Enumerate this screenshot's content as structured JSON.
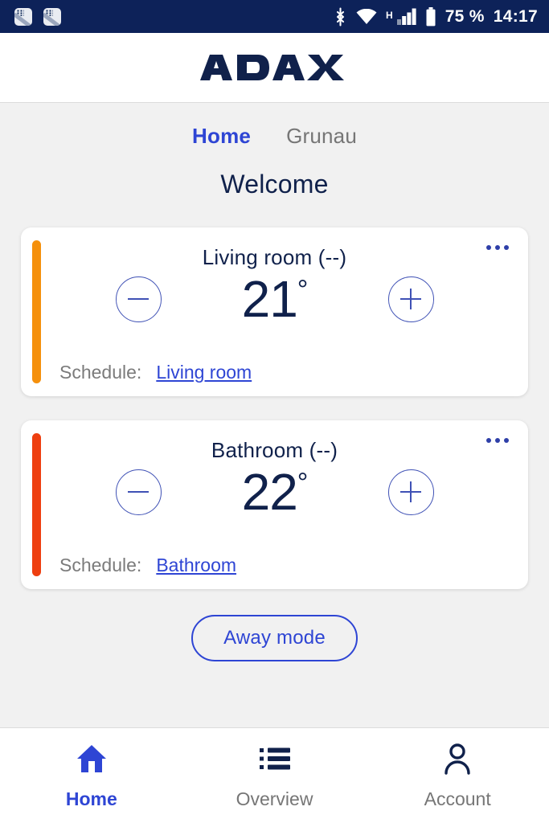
{
  "status_bar": {
    "notification_icons": [
      "app-notification-icon",
      "app-notification-icon"
    ],
    "bluetooth_icon": "bluetooth-icon",
    "wifi_icon": "wifi-icon",
    "network_type": "H",
    "signal_icon": "cellular-signal-icon",
    "battery_icon": "battery-icon",
    "battery_percent": "75 %",
    "time": "14:17",
    "background_color": "#0d2259"
  },
  "app_header": {
    "logo_text": "ADAX",
    "logo_color": "#10214b"
  },
  "tabs": [
    {
      "label": "Home",
      "active": true
    },
    {
      "label": "Grunau",
      "active": false
    }
  ],
  "page_title": "Welcome",
  "rooms": [
    {
      "name": "Living room (--)",
      "temperature": "21",
      "degree": "°",
      "accent_color": "#f5900c",
      "decrease_label": "−",
      "increase_label": "+",
      "menu_label": "···",
      "schedule_label": "Schedule:",
      "schedule_link": "Living room"
    },
    {
      "name": "Bathroom (--)",
      "temperature": "22",
      "degree": "°",
      "accent_color": "#ee3f10",
      "decrease_label": "−",
      "increase_label": "+",
      "menu_label": "···",
      "schedule_label": "Schedule:",
      "schedule_link": "Bathroom"
    }
  ],
  "away_button": {
    "label": "Away mode",
    "color": "#2e45d4"
  },
  "bottom_nav": [
    {
      "label": "Home",
      "icon": "home-icon",
      "active": true
    },
    {
      "label": "Overview",
      "icon": "list-icon",
      "active": false
    },
    {
      "label": "Account",
      "icon": "person-icon",
      "active": false
    }
  ],
  "theme": {
    "accent_blue": "#2e45d4",
    "navy": "#10214b",
    "page_bg": "#f1f1f1",
    "card_bg": "#ffffff",
    "muted_text": "#767676"
  }
}
